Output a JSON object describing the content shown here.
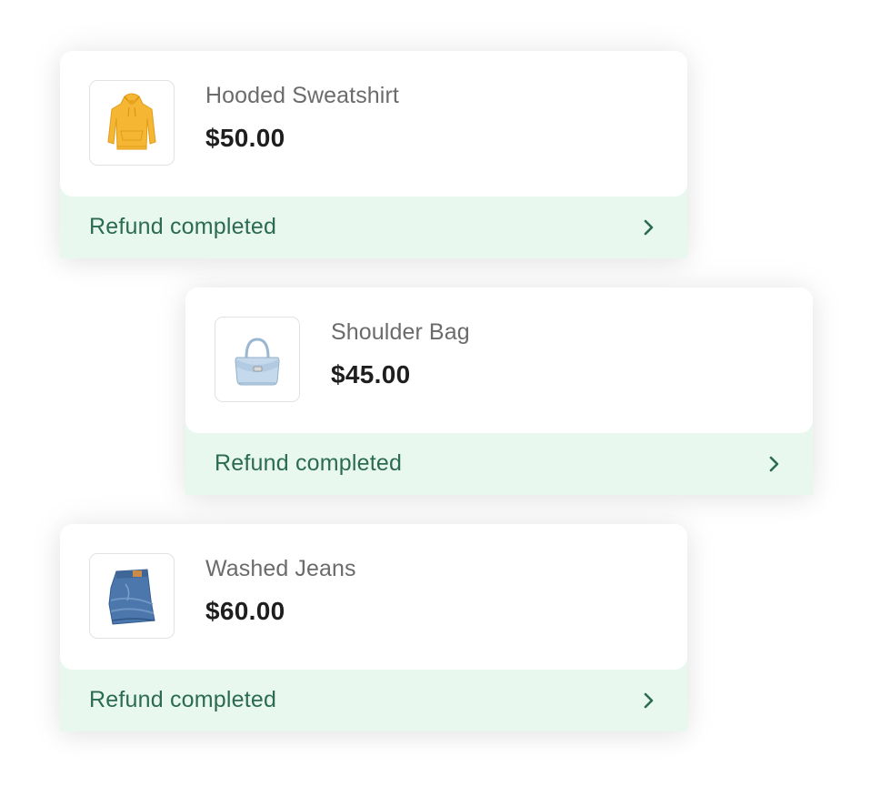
{
  "colors": {
    "status_background": "#e9f8ee",
    "status_text": "#2b6b51",
    "name_text": "#6b6b6b",
    "price_text": "#1e1e1e"
  },
  "orders": [
    {
      "product_name": "Hooded Sweatshirt",
      "price": "$50.00",
      "status": "Refund completed",
      "thumbnail_icon": "hoodie-icon",
      "action_icon": "chevron-right-icon"
    },
    {
      "product_name": "Shoulder Bag",
      "price": "$45.00",
      "status": "Refund completed",
      "thumbnail_icon": "handbag-icon",
      "action_icon": "chevron-right-icon"
    },
    {
      "product_name": "Washed Jeans",
      "price": "$60.00",
      "status": "Refund completed",
      "thumbnail_icon": "jeans-icon",
      "action_icon": "chevron-right-icon"
    }
  ]
}
